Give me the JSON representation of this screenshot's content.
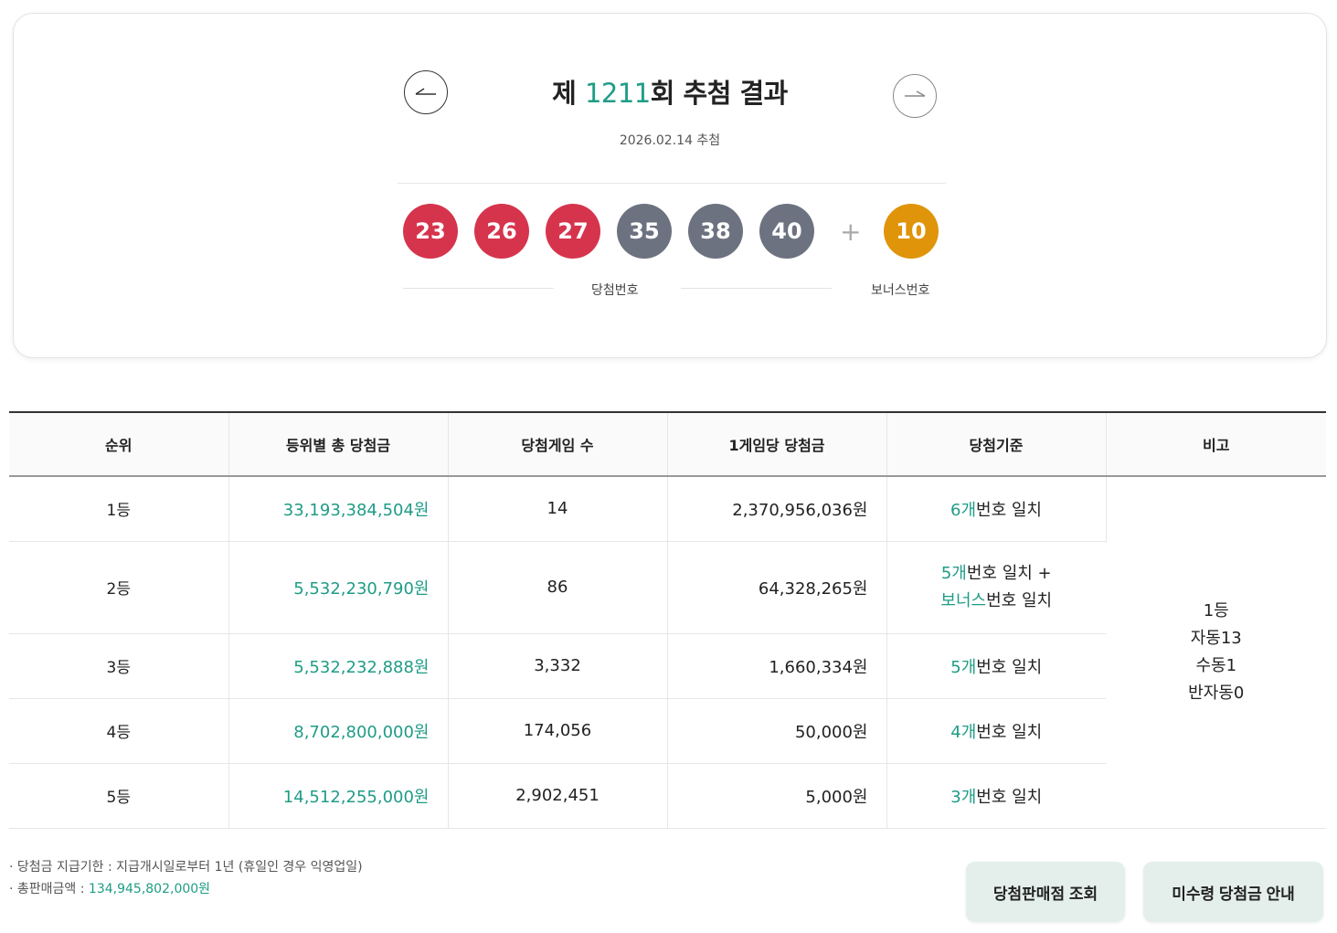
{
  "header": {
    "title_prefix": "제 ",
    "round": "1211",
    "title_suffix": "회 추첨 결과",
    "date": "2026.02.14 추첨"
  },
  "numbers": {
    "winning": [
      {
        "value": "23",
        "color": "#d6344d"
      },
      {
        "value": "26",
        "color": "#d6344d"
      },
      {
        "value": "27",
        "color": "#d6344d"
      },
      {
        "value": "35",
        "color": "#6c7280"
      },
      {
        "value": "38",
        "color": "#6c7280"
      },
      {
        "value": "40",
        "color": "#6c7280"
      }
    ],
    "plus": "+",
    "bonus": {
      "value": "10",
      "color": "#e0940a"
    },
    "winning_label": "당첨번호",
    "bonus_label": "보너스번호"
  },
  "table": {
    "headers": [
      "순위",
      "등위별 총 당첨금",
      "당첨게임 수",
      "1게임당 당첨금",
      "당첨기준",
      "비고"
    ],
    "rows": [
      {
        "rank": "1등",
        "total": "33,193,384,504원",
        "games": "14",
        "per_game": "2,370,956,036원",
        "criteria_green": "6개",
        "criteria_rest": "번호 일치"
      },
      {
        "rank": "2등",
        "total": "5,532,230,790원",
        "games": "86",
        "per_game": "64,328,265원",
        "criteria_green": "5개",
        "criteria_rest": "번호 일치 +",
        "criteria_green2": "보너스",
        "criteria_rest2": "번호 일치"
      },
      {
        "rank": "3등",
        "total": "5,532,232,888원",
        "games": "3,332",
        "per_game": "1,660,334원",
        "criteria_green": "5개",
        "criteria_rest": "번호 일치"
      },
      {
        "rank": "4등",
        "total": "8,702,800,000원",
        "games": "174,056",
        "per_game": "50,000원",
        "criteria_green": "4개",
        "criteria_rest": "번호 일치"
      },
      {
        "rank": "5등",
        "total": "14,512,255,000원",
        "games": "2,902,451",
        "per_game": "5,000원",
        "criteria_green": "3개",
        "criteria_rest": "번호 일치"
      }
    ],
    "note": [
      "1등",
      "자동13",
      "수동1",
      "반자동0"
    ]
  },
  "footer": {
    "deadline": "· 당첨금 지급기한 : 지급개시일로부터 1년 (휴일인 경우 익영업일)",
    "sales_label": "· 총판매금액 : ",
    "sales_value": "134,945,802,000원",
    "store_button": "당첨판매점 조회",
    "unclaimed_button": "미수령 당첨금 안내"
  },
  "colors": {
    "accent": "#1f9c86",
    "button_bg": "#e4efec"
  }
}
